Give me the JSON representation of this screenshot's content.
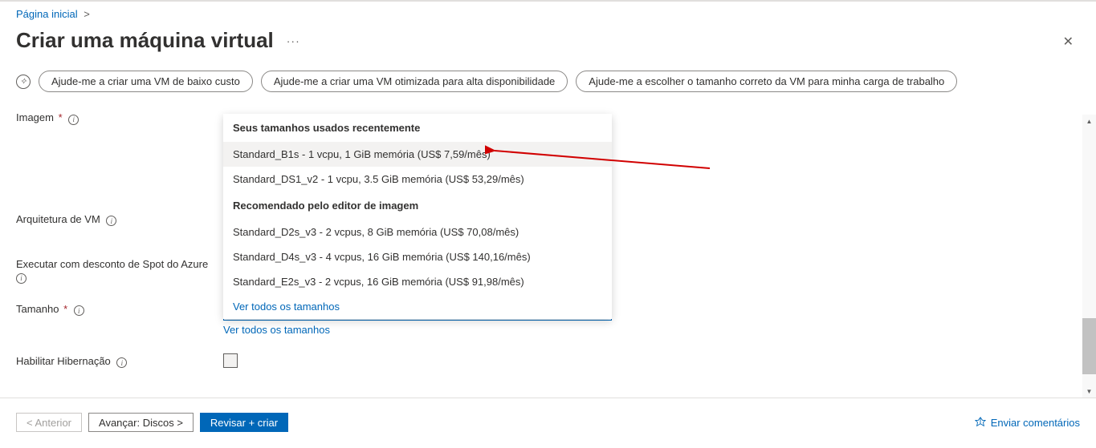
{
  "breadcrumb": {
    "home": "Página inicial"
  },
  "page_title": "Criar uma máquina virtual",
  "help_pills": {
    "low_cost": "Ajude-me a criar uma VM de baixo custo",
    "high_avail": "Ajude-me a criar uma VM otimizada para alta disponibilidade",
    "right_size": "Ajude-me a escolher o tamanho correto da VM para minha carga de trabalho"
  },
  "labels": {
    "image": "Imagem",
    "architecture": "Arquitetura de VM",
    "spot": "Executar com desconto de Spot do Azure",
    "size": "Tamanho",
    "hibernation": "Habilitar Hibernação"
  },
  "dropdown": {
    "recent_header": "Seus tamanhos usados recentemente",
    "recent": [
      "Standard_B1s - 1 vcpu, 1 GiB memória (US$ 7,59/mês)",
      "Standard_DS1_v2 - 1 vcpu, 3.5 GiB memória (US$ 53,29/mês)"
    ],
    "recommended_header": "Recomendado pelo editor de imagem",
    "recommended": [
      "Standard_D2s_v3 - 2 vcpus, 8 GiB memória (US$ 70,08/mês)",
      "Standard_D4s_v3 - 4 vcpus, 16 GiB memória (US$ 140,16/mês)",
      "Standard_E2s_v3 - 2 vcpus, 16 GiB memória (US$ 91,98/mês)"
    ],
    "see_all": "Ver todos os tamanhos"
  },
  "size_select": {
    "value": "Standard_B1s - 1 vcpu, 1 GiB memória (US$ 7,59/mês)",
    "see_all": "Ver todos os tamanhos"
  },
  "footer": {
    "previous": "< Anterior",
    "next": "Avançar: Discos >",
    "review": "Revisar + criar",
    "feedback": "Enviar comentários"
  }
}
